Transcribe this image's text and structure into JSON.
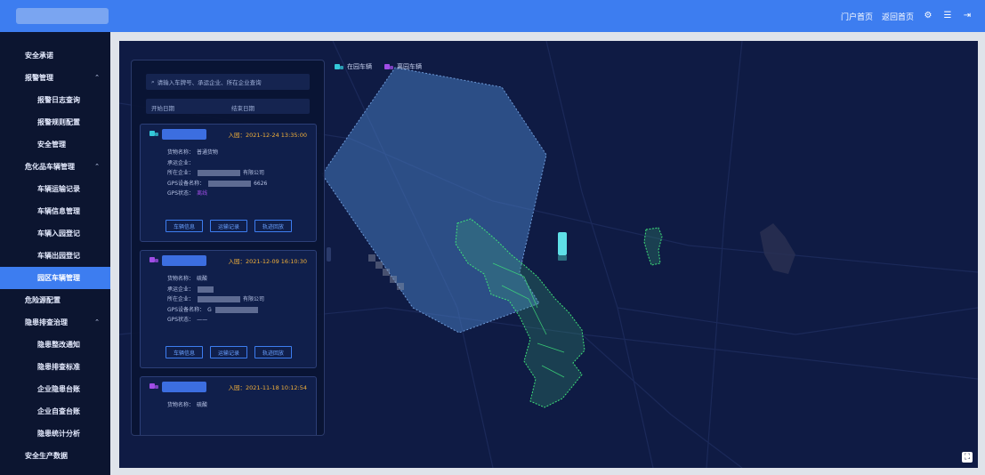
{
  "header": {
    "links": [
      "门户首页",
      "返回首页"
    ],
    "icons": [
      "settings-icon",
      "menu-icon",
      "logout-icon"
    ]
  },
  "sidebar": {
    "items": [
      {
        "label": "安全承诺",
        "level": 0
      },
      {
        "label": "报警管理",
        "level": 0,
        "expanded": true
      },
      {
        "label": "报警日志查询",
        "level": 1
      },
      {
        "label": "报警规则配置",
        "level": 1
      },
      {
        "label": "安全管理",
        "level": 1
      },
      {
        "label": "危化品车辆管理",
        "level": 0,
        "expanded": true
      },
      {
        "label": "车辆运输记录",
        "level": 1
      },
      {
        "label": "车辆信息管理",
        "level": 1
      },
      {
        "label": "车辆入园登记",
        "level": 1
      },
      {
        "label": "车辆出园登记",
        "level": 1
      },
      {
        "label": "园区车辆管理",
        "level": 1,
        "active": true
      },
      {
        "label": "危险源配置",
        "level": 0
      },
      {
        "label": "隐患排查治理",
        "level": 0,
        "expanded": true
      },
      {
        "label": "隐患整改通知",
        "level": 1
      },
      {
        "label": "隐患排查标准",
        "level": 1
      },
      {
        "label": "企业隐患台账",
        "level": 1
      },
      {
        "label": "企业自查台账",
        "level": 1
      },
      {
        "label": "隐患统计分析",
        "level": 1
      },
      {
        "label": "安全生产数据",
        "level": 0
      }
    ]
  },
  "legend": [
    {
      "label": "在园车辆",
      "color": "#34c8d8"
    },
    {
      "label": "离园车辆",
      "color": "#a04de6"
    }
  ],
  "filters": {
    "search_placeholder": "请输入车牌号、承运企业、所在企业查询",
    "start_date": "开始日期",
    "end_date": "结束日期"
  },
  "cards": [
    {
      "status_color": "#34c8d8",
      "time": "入园：2021-12-24 13:35:00",
      "rows": [
        {
          "label": "货物名称：",
          "value": "普通货物"
        },
        {
          "label": "承运企业：",
          "value": ""
        },
        {
          "label": "所在企业：",
          "value": "有限公司"
        },
        {
          "label": "GPS设备名称：",
          "value": "6626"
        },
        {
          "label": "GPS状态：",
          "value": "离线"
        }
      ],
      "actions": [
        "车辆信息",
        "运输记录",
        "轨迹回放"
      ]
    },
    {
      "status_color": "#a04de6",
      "time": "入园：2021-12-09 16:10:30",
      "rows": [
        {
          "label": "货物名称：",
          "value": "硫酸"
        },
        {
          "label": "承运企业：",
          "value": ""
        },
        {
          "label": "所在企业：",
          "value": "有限公司"
        },
        {
          "label": "GPS设备名称：",
          "value": "G"
        },
        {
          "label": "GPS状态：",
          "value": "——"
        }
      ],
      "actions": [
        "车辆信息",
        "运输记录",
        "轨迹回放"
      ]
    },
    {
      "status_color": "#a04de6",
      "time": "入园：2021-11-18 10:12:54",
      "rows": [
        {
          "label": "货物名称：",
          "value": "硫酸"
        }
      ],
      "actions": []
    }
  ]
}
